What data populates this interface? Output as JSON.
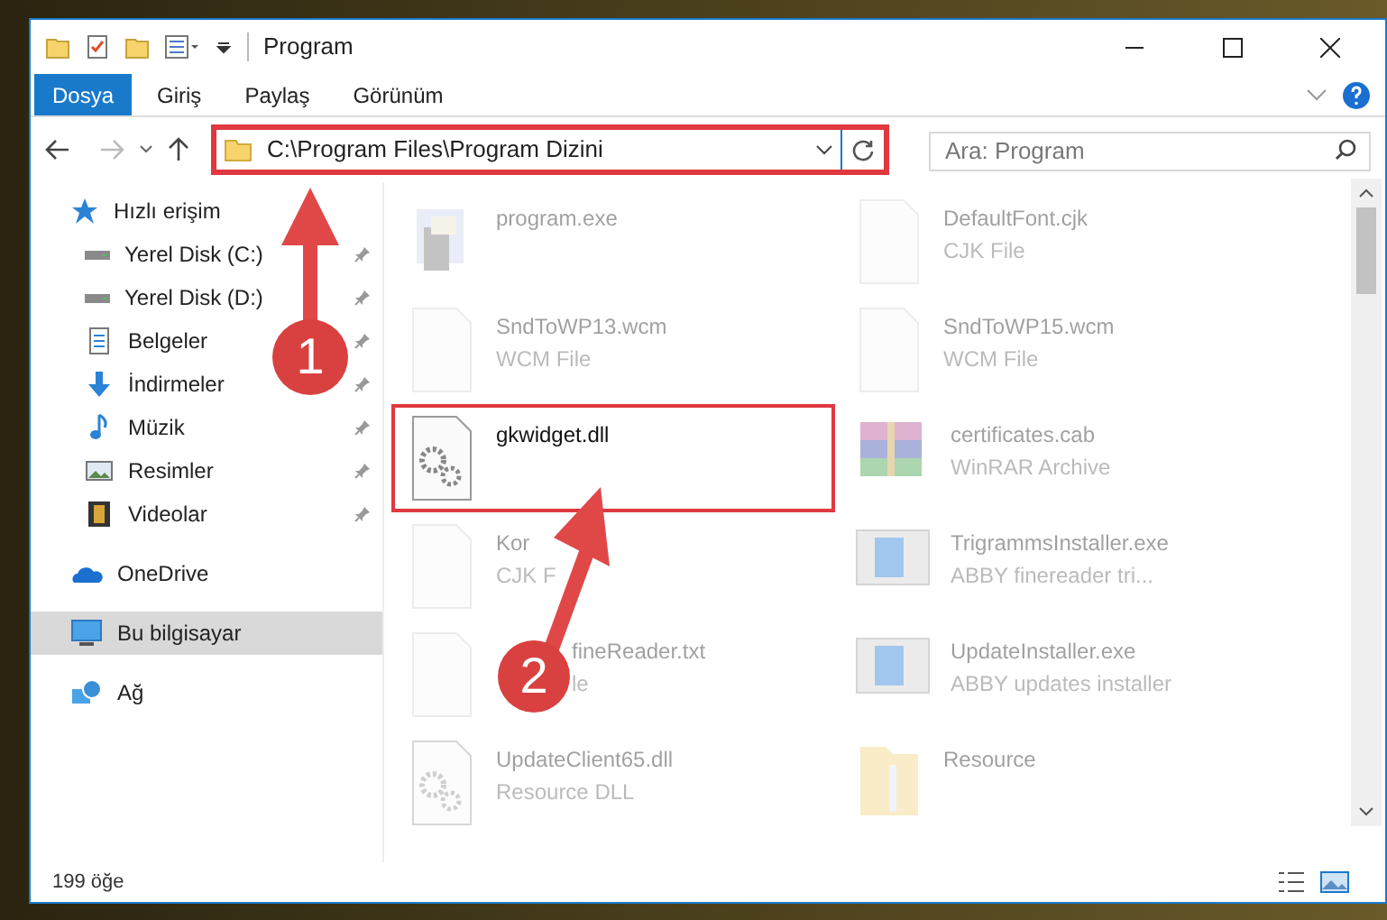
{
  "window": {
    "title": "Program"
  },
  "ribbon_tabs": [
    {
      "label": "Dosya",
      "selected": true
    },
    {
      "label": "Giriş",
      "selected": false
    },
    {
      "label": "Paylaş",
      "selected": false
    },
    {
      "label": "Görünüm",
      "selected": false
    }
  ],
  "address": {
    "path": "C:\\Program Files\\Program Dizini",
    "highlighted": true
  },
  "search": {
    "placeholder": "Ara: Program"
  },
  "sidebar": {
    "items": [
      {
        "label": "Hızlı erişim",
        "kind": "header",
        "selected": false,
        "children": [
          {
            "label": "Yerel Disk (C:)",
            "kind": "drive",
            "selected": false,
            "pinned": true
          },
          {
            "label": "Yerel Disk (D:)",
            "kind": "drive",
            "selected": false,
            "pinned": true
          },
          {
            "label": "Belgeler",
            "kind": "docs",
            "selected": false,
            "pinned": true
          },
          {
            "label": "İndirmeler",
            "kind": "download",
            "selected": false,
            "pinned": true
          },
          {
            "label": "Müzik",
            "kind": "music",
            "selected": false,
            "pinned": true
          },
          {
            "label": "Resimler",
            "kind": "pictures",
            "selected": false,
            "pinned": true
          },
          {
            "label": "Videolar",
            "kind": "video",
            "selected": false,
            "pinned": true
          }
        ]
      },
      {
        "label": "OneDrive",
        "kind": "cloud",
        "selected": false
      },
      {
        "label": "Bu bilgisayar",
        "kind": "pc",
        "selected": true
      },
      {
        "label": "Ağ",
        "kind": "network",
        "selected": false
      }
    ]
  },
  "files": [
    {
      "name": "program.exe",
      "kind": "exe",
      "faded": true,
      "highlighted": false
    },
    {
      "name": "DefaultFont.cjk",
      "type": "CJK File",
      "kind": "blank",
      "faded": true,
      "highlighted": false
    },
    {
      "name": "SndToWP13.wcm",
      "type": "WCM File",
      "kind": "blank",
      "faded": true,
      "highlighted": false
    },
    {
      "name": "SndToWP15.wcm",
      "type": "WCM File",
      "kind": "blank",
      "faded": true,
      "highlighted": false
    },
    {
      "name": "gkwidget.dll",
      "kind": "dll",
      "faded": false,
      "highlighted": true
    },
    {
      "name": "certificates.cab",
      "type": "WinRAR Archive",
      "kind": "rar",
      "faded": true,
      "highlighted": false
    },
    {
      "name": "Kor",
      "type": "CJK F",
      "kind": "blank",
      "faded": true,
      "highlighted": false
    },
    {
      "name": "TrigrammsInstaller.exe",
      "type": "ABBY finereader tri...",
      "kind": "setup",
      "faded": true,
      "highlighted": false
    },
    {
      "name": "fineReader.txt",
      "type": "le",
      "kind": "blank",
      "faded": true,
      "highlighted": false,
      "obscured": true
    },
    {
      "name": "UpdateInstaller.exe",
      "type": "ABBY updates installer",
      "kind": "setup",
      "faded": true,
      "highlighted": false
    },
    {
      "name": "UpdateClient65.dll",
      "type": "Resource DLL",
      "kind": "dll",
      "faded": true,
      "highlighted": false
    },
    {
      "name": "Resource",
      "kind": "folder",
      "faded": true,
      "highlighted": false
    }
  ],
  "status_bar": {
    "count": "199 öğe"
  },
  "callouts": [
    {
      "number": "1"
    },
    {
      "number": "2"
    }
  ]
}
